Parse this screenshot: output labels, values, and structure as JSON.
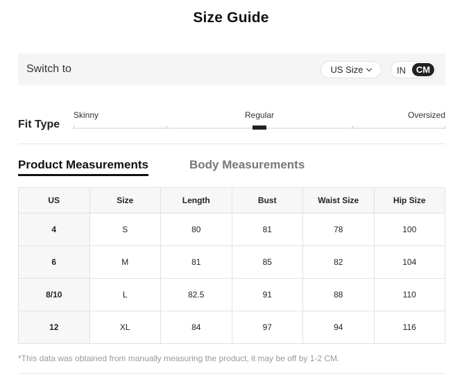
{
  "title": "Size Guide",
  "switch_bar": {
    "label": "Switch to",
    "size_select": {
      "selected": "US Size",
      "icon": "chevron-down-icon"
    },
    "unit_toggle": {
      "options": [
        "IN",
        "CM"
      ],
      "selected": "CM"
    }
  },
  "fit_type": {
    "label": "Fit Type",
    "scale": [
      "Skinny",
      "Regular",
      "Oversized"
    ],
    "selected": "Regular"
  },
  "tabs": [
    {
      "label": "Product Measurements",
      "active": true
    },
    {
      "label": "Body Measurements",
      "active": false
    }
  ],
  "table": {
    "headers": [
      "US",
      "Size",
      "Length",
      "Bust",
      "Waist Size",
      "Hip Size"
    ],
    "rows": [
      [
        "4",
        "S",
        "80",
        "81",
        "78",
        "100"
      ],
      [
        "6",
        "M",
        "81",
        "85",
        "82",
        "104"
      ],
      [
        "8/10",
        "L",
        "82.5",
        "91",
        "88",
        "110"
      ],
      [
        "12",
        "XL",
        "84",
        "97",
        "94",
        "116"
      ]
    ]
  },
  "footnote": "*This data was obtained from manually measuring the product, it may be off by 1-2 CM.",
  "colors": {
    "accent": "#222222",
    "panel": "#f5f5f5",
    "border": "#e2e2e2",
    "muted": "#777777"
  }
}
